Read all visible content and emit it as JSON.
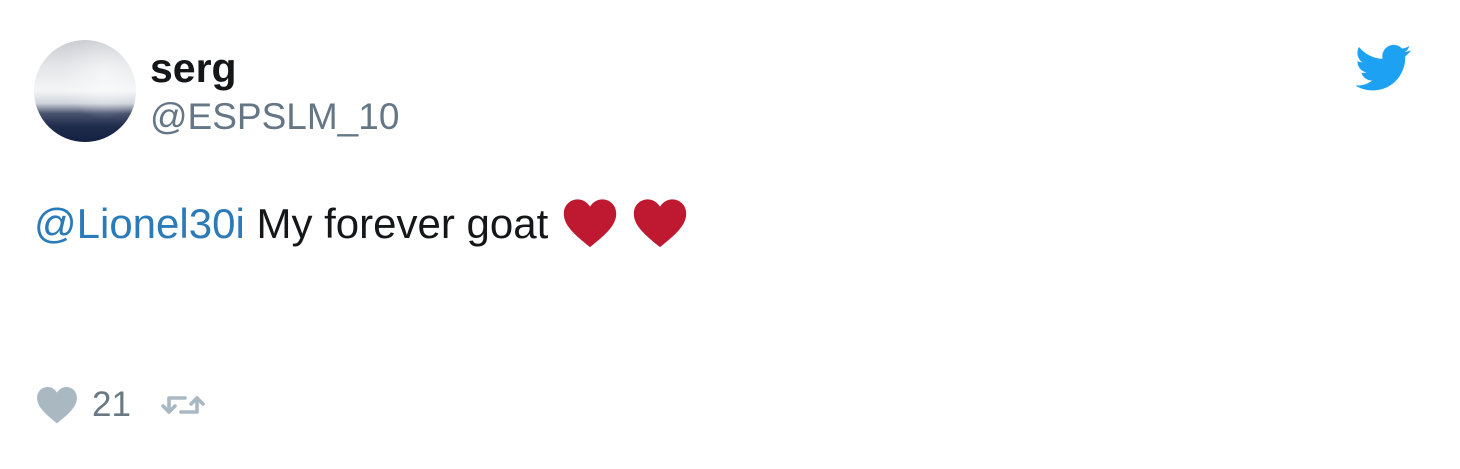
{
  "tweet": {
    "display_name": "serg",
    "handle": "@ESPSLM_10",
    "mention": "@Lionel30i",
    "body": "My forever goat",
    "emoji_icons": [
      "red-heart-icon",
      "red-heart-icon"
    ],
    "like_count": "21"
  },
  "icons": {
    "brand": "twitter-bird-icon",
    "like": "heart-icon",
    "retweet": "retweet-icon"
  },
  "colors": {
    "brand_blue": "#1da1f2",
    "mention_blue": "#2b7bb9",
    "heart_red": "#be1931",
    "muted_gray": "#657786",
    "action_gray": "#aab8c2"
  }
}
